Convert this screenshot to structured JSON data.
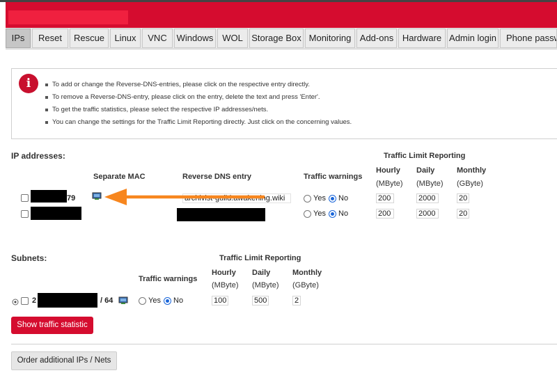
{
  "tabs": [
    "IPs",
    "Reset",
    "Rescue",
    "Linux",
    "VNC",
    "Windows",
    "WOL",
    "Storage Box",
    "Monitoring",
    "Add-ons",
    "Hardware",
    "Admin login",
    "Phone passwo"
  ],
  "info": {
    "icon": "info-icon",
    "bullets": [
      "To add or change the Reverse-DNS-entries, please click on the respective entry directly.",
      "To remove a Reverse-DNS-entry, please click on the entry, delete the text and press 'Enter'.",
      "To get the traffic statistics, please select the respective IP addresses/nets.",
      "You can change the settings for the Traffic Limit Reporting directly. Just click on the concerning values."
    ]
  },
  "ip_section": {
    "title": "IP addresses:",
    "col_separate_mac": "Separate MAC",
    "col_reverse_dns": "Reverse DNS entry",
    "col_traffic_warnings": "Traffic warnings",
    "col_traffic_limit": "Traffic Limit Reporting",
    "col_hourly": "Hourly",
    "col_daily": "Daily",
    "col_monthly": "Monthly",
    "unit_hourly": "(MByte)",
    "unit_daily": "(MByte)",
    "unit_monthly": "(GByte)",
    "rows": [
      {
        "ip_suffix": "79",
        "rdns": "archivist-guild.awakening.wiki",
        "yes": "Yes",
        "no": "No",
        "hourly": "200",
        "daily": "2000",
        "monthly": "20"
      },
      {
        "ip_suffix": "",
        "rdns": "",
        "yes": "Yes",
        "no": "No",
        "hourly": "200",
        "daily": "2000",
        "monthly": "20"
      }
    ]
  },
  "subnet_section": {
    "title": "Subnets:",
    "col_traffic_warnings": "Traffic warnings",
    "col_traffic_limit": "Traffic Limit Reporting",
    "col_hourly": "Hourly",
    "col_daily": "Daily",
    "col_monthly": "Monthly",
    "unit_hourly": "(MByte)",
    "unit_daily": "(MByte)",
    "unit_monthly": "(GByte)",
    "row": {
      "prefix_start": "2",
      "prefix_len": "/ 64",
      "yes": "Yes",
      "no": "No",
      "hourly": "100",
      "daily": "500",
      "monthly": "2"
    }
  },
  "buttons": {
    "show_traffic": "Show traffic statistic",
    "order_ips": "Order additional IPs / Nets"
  },
  "colors": {
    "brand_red": "#d50c2f",
    "arrow_orange": "#f7861e",
    "radio_blue": "#1a66d9"
  }
}
